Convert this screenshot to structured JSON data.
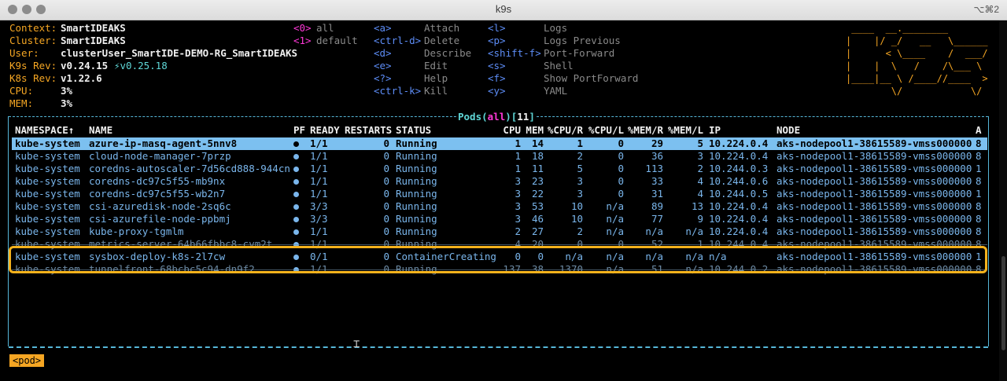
{
  "window": {
    "title": "k9s",
    "shortcut": "⌥⌘2"
  },
  "info": [
    {
      "label": "Context:",
      "value": "SmartIDEAKS"
    },
    {
      "label": "Cluster:",
      "value": "SmartIDEAKS"
    },
    {
      "label": "User:",
      "value": "clusterUser_SmartIDE-DEMO-RG_SmartIDEAKS"
    },
    {
      "label": "K9s Rev:",
      "value": "v0.24.15",
      "extra": "⚡v0.25.18"
    },
    {
      "label": "K8s Rev:",
      "value": "v1.22.6"
    },
    {
      "label": "CPU:",
      "value": "3%"
    },
    {
      "label": "MEM:",
      "value": "3%"
    }
  ],
  "namespaces": [
    {
      "key": "<0>",
      "label": "all"
    },
    {
      "key": "<1>",
      "label": "default"
    }
  ],
  "shortcuts_col1": [
    {
      "key": "<a>",
      "label": "Attach"
    },
    {
      "key": "<ctrl-d>",
      "label": "Delete"
    },
    {
      "key": "<d>",
      "label": "Describe"
    },
    {
      "key": "<e>",
      "label": "Edit"
    },
    {
      "key": "<?>",
      "label": "Help"
    },
    {
      "key": "<ctrl-k>",
      "label": "Kill"
    }
  ],
  "shortcuts_col2": [
    {
      "key": "<l>",
      "label": "Logs"
    },
    {
      "key": "<p>",
      "label": "Logs Previous"
    },
    {
      "key": "<shift-f>",
      "label": "Port-Forward"
    },
    {
      "key": "<s>",
      "label": "Shell"
    },
    {
      "key": "<f>",
      "label": "Show PortForward"
    },
    {
      "key": "<y>",
      "label": "YAML"
    }
  ],
  "logo_lines": [
    " ____  __.________       ",
    "|    |/ _/   __   \\______",
    "|      < \\____    /  ___/",
    "|    |  \\   /    /\\___ \\ ",
    "|____|__ \\ /____//____  >",
    "        \\/            \\/ "
  ],
  "table": {
    "title_prefix": "Pods",
    "title_scope": "all",
    "title_count": "11",
    "headers": {
      "namespace": "NAMESPACE↑",
      "name": "NAME",
      "pf": "PF",
      "ready": "READY",
      "restarts": "RESTARTS",
      "status": "STATUS",
      "cpu": "CPU",
      "mem": "MEM",
      "cpu_r": "%CPU/R",
      "cpu_l": "%CPU/L",
      "mem_r": "%MEM/R",
      "mem_l": "%MEM/L",
      "ip": "IP",
      "node": "NODE",
      "age": "A"
    },
    "rows": [
      {
        "namespace": "kube-system",
        "name": "azure-ip-masq-agent-5nnv8",
        "ready": "1/1",
        "restarts": "0",
        "status": "Running",
        "cpu": "1",
        "mem": "14",
        "cpu_r": "1",
        "cpu_l": "0",
        "mem_r": "29",
        "mem_l": "5",
        "ip": "10.224.0.4",
        "node": "aks-nodepool1-38615589-vmss000000",
        "age": "8"
      },
      {
        "namespace": "kube-system",
        "name": "cloud-node-manager-7przp",
        "ready": "1/1",
        "restarts": "0",
        "status": "Running",
        "cpu": "1",
        "mem": "18",
        "cpu_r": "2",
        "cpu_l": "0",
        "mem_r": "36",
        "mem_l": "3",
        "ip": "10.224.0.4",
        "node": "aks-nodepool1-38615589-vmss000000",
        "age": "8"
      },
      {
        "namespace": "kube-system",
        "name": "coredns-autoscaler-7d56cd888-944cn",
        "ready": "1/1",
        "restarts": "0",
        "status": "Running",
        "cpu": "1",
        "mem": "11",
        "cpu_r": "5",
        "cpu_l": "0",
        "mem_r": "113",
        "mem_l": "2",
        "ip": "10.244.0.3",
        "node": "aks-nodepool1-38615589-vmss000000",
        "age": "1"
      },
      {
        "namespace": "kube-system",
        "name": "coredns-dc97c5f55-mb9nx",
        "ready": "1/1",
        "restarts": "0",
        "status": "Running",
        "cpu": "3",
        "mem": "23",
        "cpu_r": "3",
        "cpu_l": "0",
        "mem_r": "33",
        "mem_l": "4",
        "ip": "10.244.0.6",
        "node": "aks-nodepool1-38615589-vmss000000",
        "age": "8"
      },
      {
        "namespace": "kube-system",
        "name": "coredns-dc97c5f55-wb2n7",
        "ready": "1/1",
        "restarts": "0",
        "status": "Running",
        "cpu": "3",
        "mem": "22",
        "cpu_r": "3",
        "cpu_l": "0",
        "mem_r": "31",
        "mem_l": "4",
        "ip": "10.244.0.5",
        "node": "aks-nodepool1-38615589-vmss000000",
        "age": "1"
      },
      {
        "namespace": "kube-system",
        "name": "csi-azuredisk-node-2sq6c",
        "ready": "3/3",
        "restarts": "0",
        "status": "Running",
        "cpu": "3",
        "mem": "53",
        "cpu_r": "10",
        "cpu_l": "n/a",
        "mem_r": "89",
        "mem_l": "13",
        "ip": "10.224.0.4",
        "node": "aks-nodepool1-38615589-vmss000000",
        "age": "8"
      },
      {
        "namespace": "kube-system",
        "name": "csi-azurefile-node-ppbmj",
        "ready": "3/3",
        "restarts": "0",
        "status": "Running",
        "cpu": "3",
        "mem": "46",
        "cpu_r": "10",
        "cpu_l": "n/a",
        "mem_r": "77",
        "mem_l": "9",
        "ip": "10.224.0.4",
        "node": "aks-nodepool1-38615589-vmss000000",
        "age": "8"
      },
      {
        "namespace": "kube-system",
        "name": "kube-proxy-tgmlm",
        "ready": "1/1",
        "restarts": "0",
        "status": "Running",
        "cpu": "2",
        "mem": "27",
        "cpu_r": "2",
        "cpu_l": "n/a",
        "mem_r": "n/a",
        "mem_l": "n/a",
        "ip": "10.224.0.4",
        "node": "aks-nodepool1-38615589-vmss000000",
        "age": "8"
      },
      {
        "namespace": "kube-system",
        "name": "metrics-server-64b66fbbc8-cvm2t",
        "ready": "1/1",
        "restarts": "0",
        "status": "Running",
        "cpu": "4",
        "mem": "20",
        "cpu_r": "0",
        "cpu_l": "0",
        "mem_r": "52",
        "mem_l": "1",
        "ip": "10.244.0.4",
        "node": "aks-nodepool1-38615589-vmss000000",
        "age": "8"
      },
      {
        "namespace": "kube-system",
        "name": "sysbox-deploy-k8s-2l7cw",
        "ready": "0/1",
        "restarts": "0",
        "status": "ContainerCreating",
        "cpu": "0",
        "mem": "0",
        "cpu_r": "n/a",
        "cpu_l": "n/a",
        "mem_r": "n/a",
        "mem_l": "n/a",
        "ip": "n/a",
        "node": "aks-nodepool1-38615589-vmss000000",
        "age": "1"
      },
      {
        "namespace": "kube-system",
        "name": "tunnelfront-68bcbc5c94-dn9f2",
        "ready": "1/1",
        "restarts": "0",
        "status": "Running",
        "cpu": "137",
        "mem": "38",
        "cpu_r": "1370",
        "cpu_l": "n/a",
        "mem_r": "51",
        "mem_l": "n/a",
        "ip": "10.244.0.2",
        "node": "aks-nodepool1-38615589-vmss000000",
        "age": "8"
      }
    ]
  },
  "breadcrumb": "<pod>",
  "colors": {
    "accent": "#f5a623",
    "header_label": "#f5a623",
    "key_blue": "#5d8df7",
    "key_magenta": "#ff38d8",
    "row_text": "#7ab6ec",
    "selection_bg": "#7cc0f0",
    "highlight_box": "#f5b21c"
  }
}
